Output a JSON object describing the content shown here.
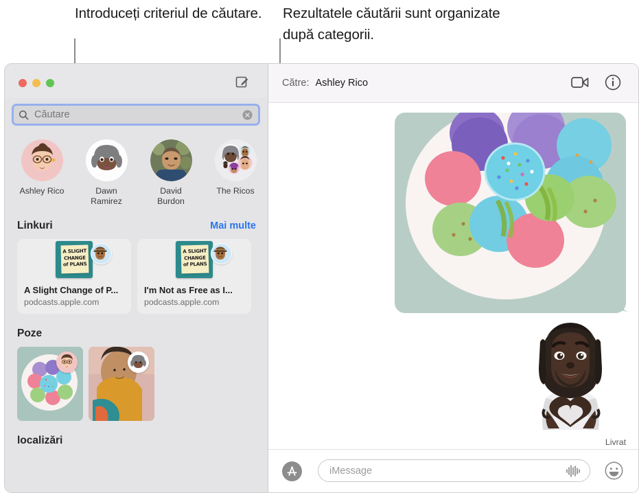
{
  "callouts": {
    "left": "Introduceți criteriul de căutare.",
    "right": "Rezultatele căutării sunt organizate după categorii."
  },
  "window": {
    "traffic_lights": {
      "close_color": "#ec6a5f",
      "minimize_color": "#f4bd4f",
      "zoom_color": "#61c554"
    },
    "compose_icon": "compose-icon"
  },
  "sidebar": {
    "search": {
      "placeholder": "Căutare",
      "value": "",
      "icon": "search-icon",
      "clear_icon": "clear-icon",
      "focus_ring_color": "#95b0ee"
    },
    "contacts": [
      {
        "name": "Ashley Rico",
        "avatar": "memoji-ashley"
      },
      {
        "name": "Dawn Ramirez",
        "avatar": "memoji-dawn"
      },
      {
        "name": "David Burdon",
        "avatar": "photo-david"
      },
      {
        "name": "The Ricos",
        "avatar": "group-the-ricos"
      }
    ],
    "links_section": {
      "title": "Linkuri",
      "more_label": "Mai multe",
      "more_color": "#2b76f0",
      "cards": [
        {
          "title": "A Slight Change of P...",
          "host": "podcasts.apple.com",
          "artwork_text": "A SLIGHT CHANGE of PLANS",
          "artwork_color": "#2c8a8c"
        },
        {
          "title": "I'm Not as Free as I...",
          "host": "podcasts.apple.com",
          "artwork_text": "A SLIGHT CHANGE of PLANS",
          "artwork_color": "#2c8a8c"
        }
      ]
    },
    "photos_section": {
      "title": "Poze",
      "items": [
        {
          "name": "photo-macarons",
          "badge": "memoji-ashley"
        },
        {
          "name": "photo-woman-orange-scarf",
          "badge": "memoji-dawn"
        }
      ]
    },
    "locations_section": {
      "title": "localizări"
    }
  },
  "conversation": {
    "to_label": "Către:",
    "to_name": "Ashley Rico",
    "facetime_icon": "facetime-video-icon",
    "info_icon": "info-icon",
    "messages": [
      {
        "type": "image",
        "name": "photo-macarons-bubble"
      },
      {
        "type": "sticker",
        "name": "memoji-heart-hands-sticker"
      }
    ],
    "status": "Livrat",
    "composer": {
      "appstore_icon": "app-store-icon",
      "placeholder": "iMessage",
      "value": "",
      "audio_icon": "audio-waveform-icon",
      "emoji_icon": "emoji-smiley-icon"
    }
  }
}
